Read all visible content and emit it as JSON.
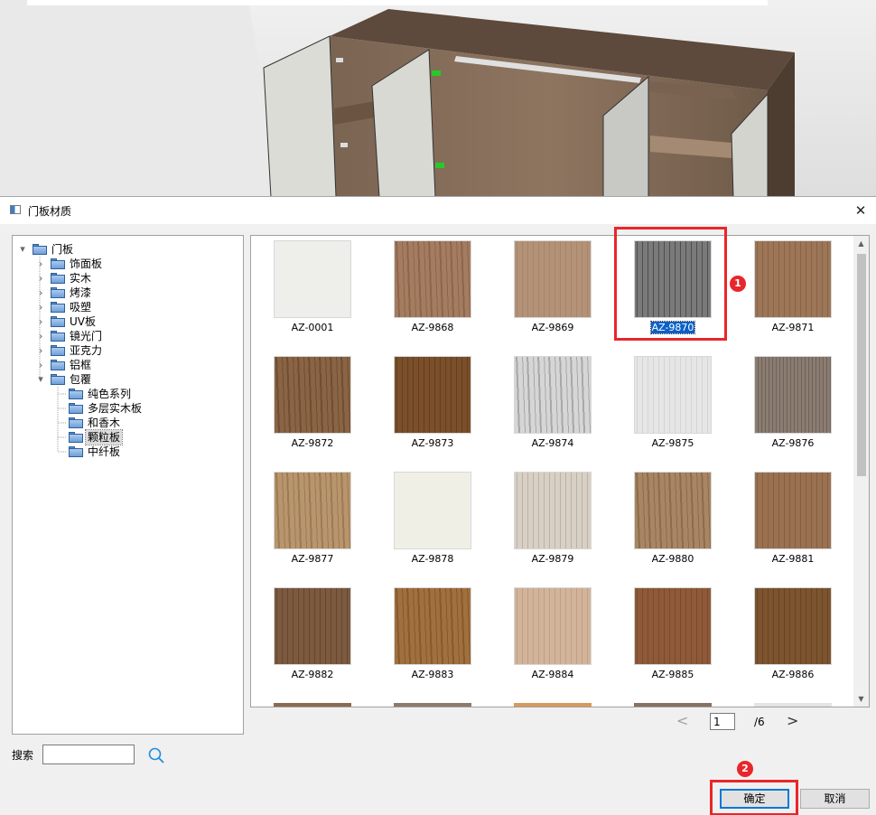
{
  "dialog": {
    "title": "门板材质",
    "close_glyph": "✕"
  },
  "tree": {
    "root": "门板",
    "items": [
      {
        "label": "饰面板",
        "level": 1
      },
      {
        "label": "实木",
        "level": 1
      },
      {
        "label": "烤漆",
        "level": 1
      },
      {
        "label": "吸塑",
        "level": 1
      },
      {
        "label": "UV板",
        "level": 1
      },
      {
        "label": "镜光门",
        "level": 1
      },
      {
        "label": "亚克力",
        "level": 1
      },
      {
        "label": "铝框",
        "level": 1
      },
      {
        "label": "包覆",
        "level": 1,
        "expanded": true
      },
      {
        "label": "纯色系列",
        "level": 2
      },
      {
        "label": "多层实木板",
        "level": 2
      },
      {
        "label": "和香木",
        "level": 2
      },
      {
        "label": "颗粒板",
        "level": 2,
        "selected": true
      },
      {
        "label": "中纤板",
        "level": 2
      }
    ]
  },
  "materials": [
    {
      "code": "AZ-0001",
      "color": "#eeeeea",
      "color2": "#e6e6e2",
      "grain": "none"
    },
    {
      "code": "AZ-9868",
      "color": "#a47c60",
      "color2": "#8c664c",
      "grain": "wood"
    },
    {
      "code": "AZ-9869",
      "color": "#b49277",
      "color2": "#a68569",
      "grain": "fine"
    },
    {
      "code": "AZ-9870",
      "color": "#7a7a7a",
      "color2": "#4e4e4e",
      "grain": "fine",
      "selected": true
    },
    {
      "code": "AZ-9871",
      "color": "#9c7657",
      "color2": "#876348",
      "grain": "fine"
    },
    {
      "code": "AZ-9872",
      "color": "#8a6444",
      "color2": "#6e4e34",
      "grain": "wood"
    },
    {
      "code": "AZ-9873",
      "color": "#7a4f2a",
      "color2": "#643e1e",
      "grain": "fine"
    },
    {
      "code": "AZ-9874",
      "color": "#d6d6d6",
      "color2": "#a8a8a8",
      "grain": "wood"
    },
    {
      "code": "AZ-9875",
      "color": "#e6e6e6",
      "color2": "#d4d4d4",
      "grain": "fine"
    },
    {
      "code": "AZ-9876",
      "color": "#8a7c70",
      "color2": "#6e625a",
      "grain": "cross"
    },
    {
      "code": "AZ-9877",
      "color": "#b8956c",
      "color2": "#9c7a54",
      "grain": "wood"
    },
    {
      "code": "AZ-9878",
      "color": "#f0efe6",
      "color2": "#e8e7de",
      "grain": "none"
    },
    {
      "code": "AZ-9879",
      "color": "#d8d0c4",
      "color2": "#bcb2a4",
      "grain": "fine"
    },
    {
      "code": "AZ-9880",
      "color": "#a88664",
      "color2": "#8c6c4c",
      "grain": "wood"
    },
    {
      "code": "AZ-9881",
      "color": "#9a7252",
      "color2": "#84603f",
      "grain": "fine"
    },
    {
      "code": "AZ-9882",
      "color": "#7c5a40",
      "color2": "#664630",
      "grain": "fine"
    },
    {
      "code": "AZ-9883",
      "color": "#a0703e",
      "color2": "#88592c",
      "grain": "wood"
    },
    {
      "code": "AZ-9884",
      "color": "#d2b49a",
      "color2": "#c0a086",
      "grain": "fine"
    },
    {
      "code": "AZ-9885",
      "color": "#8e5a3a",
      "color2": "#7a4a2c",
      "grain": "fine"
    },
    {
      "code": "AZ-9886",
      "color": "#7c5430",
      "color2": "#684420",
      "grain": "fine"
    }
  ],
  "partial_row_colors": [
    "#8a6a50",
    "#8c7a6a",
    "#d89a5a",
    "#8a7060",
    "#e4e4e4"
  ],
  "pager": {
    "prev_glyph": "<",
    "page": "1",
    "total": "/6",
    "next_glyph": ">"
  },
  "search": {
    "label": "搜索",
    "value": ""
  },
  "buttons": {
    "ok": "确定",
    "cancel": "取消"
  },
  "annotations": {
    "badge1": "1",
    "badge2": "2",
    "color": "#e8262b"
  }
}
